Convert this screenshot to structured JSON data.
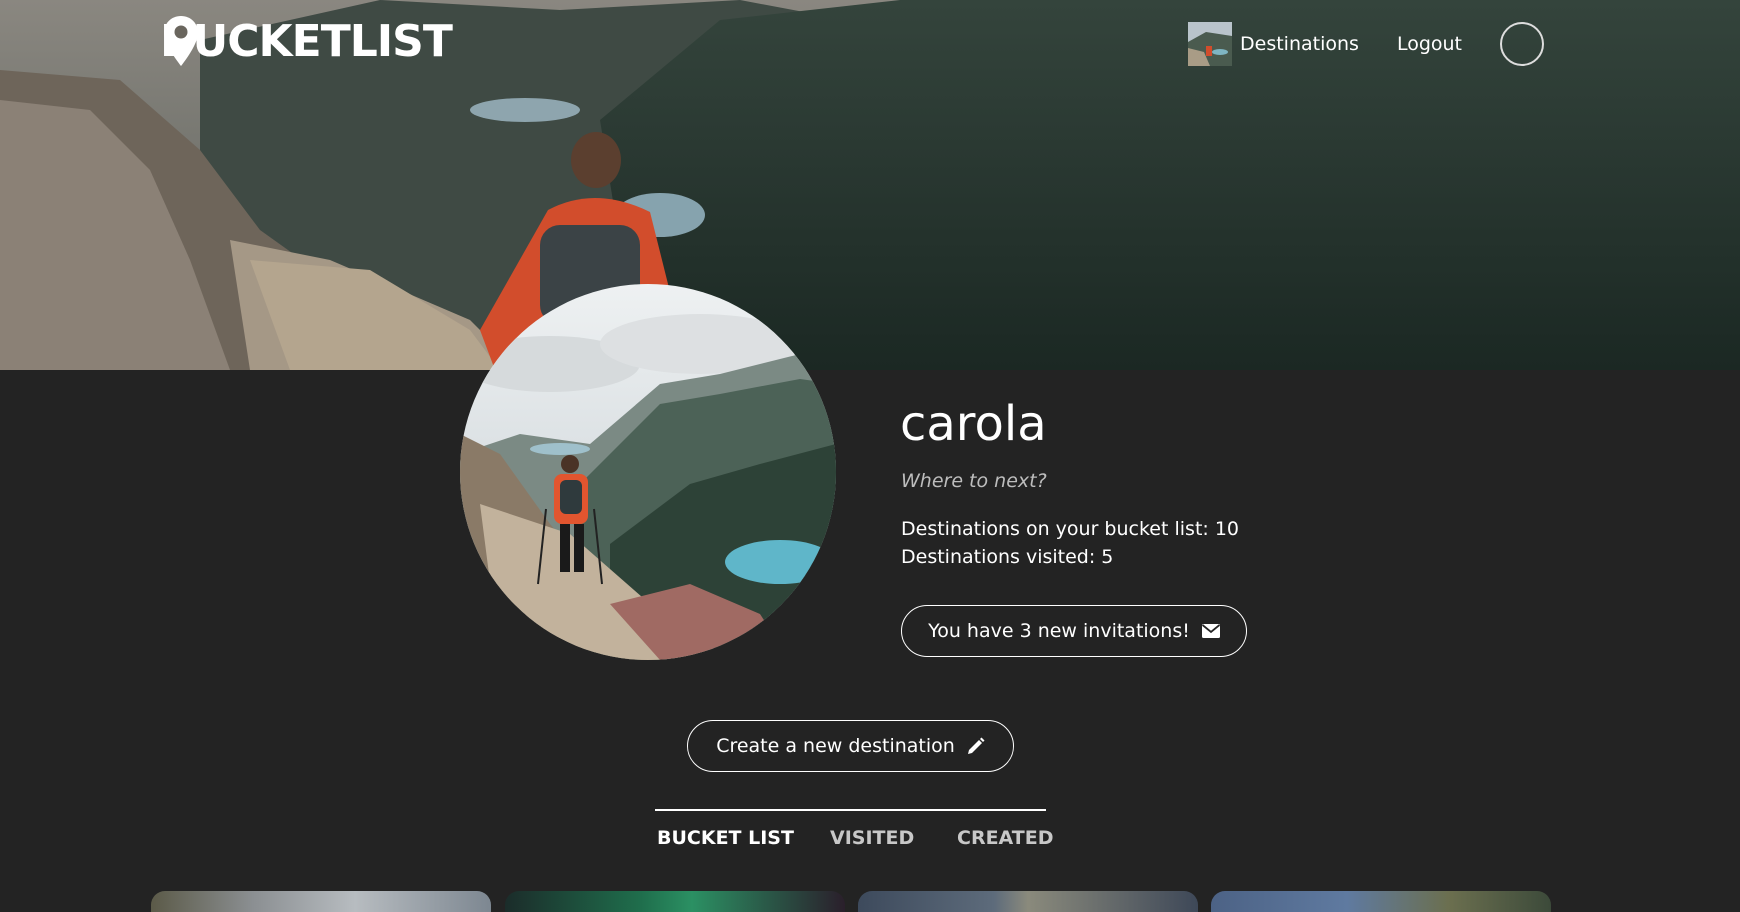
{
  "header": {
    "logo_left": "BUCKET",
    "logo_right": "LIST",
    "search_icon": "search-icon",
    "nav_links": [
      "Destinations",
      "Logout"
    ]
  },
  "profile": {
    "username": "carola",
    "tagline": "Where to next?",
    "stats": {
      "bucket_list": "Destinations on your bucket list: 10",
      "visited": "Destinations visited: 5"
    },
    "invite_button": "You have 3 new invitations!",
    "invite_icon": "envelope-icon",
    "create_button": "Create a new destination",
    "create_icon": "pencil-icon"
  },
  "tabs": [
    "BUCKET LIST",
    "VISITED",
    "CREATED"
  ],
  "active_tab": "BUCKET LIST",
  "colors": {
    "background": "#232323",
    "text": "#ffffff",
    "muted_text": "#bdbdbd",
    "inactive_tab": "#c8c8c8"
  }
}
